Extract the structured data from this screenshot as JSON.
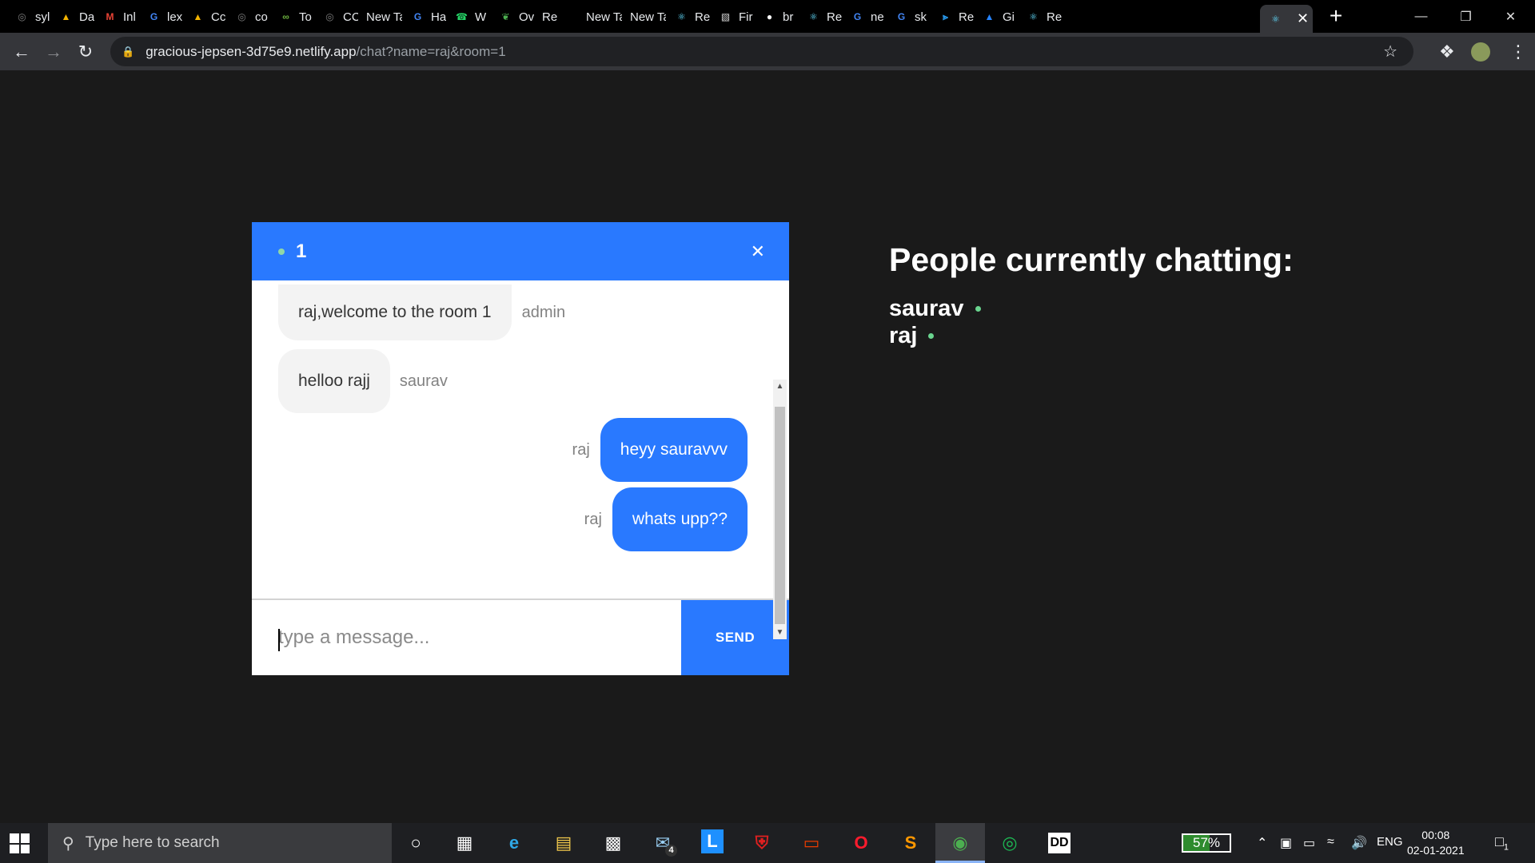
{
  "browser": {
    "tabs": [
      {
        "label": "syl",
        "favicon": "globe-icon",
        "color": "#7d7d7d"
      },
      {
        "label": "Da",
        "favicon": "drive-icon",
        "color": "#f4b400"
      },
      {
        "label": "Inl",
        "favicon": "gmail-icon",
        "color": "#ea4335"
      },
      {
        "label": "lex",
        "favicon": "google-icon",
        "color": "#4285f4"
      },
      {
        "label": "Cc",
        "favicon": "drive-icon",
        "color": "#f4b400"
      },
      {
        "label": "co",
        "favicon": "globe-icon",
        "color": "#7d7d7d"
      },
      {
        "label": "To",
        "favicon": "infinity-icon",
        "color": "#6db33f"
      },
      {
        "label": "CC",
        "favicon": "globe-icon",
        "color": "#7d7d7d"
      },
      {
        "label": "New Ta",
        "favicon": "",
        "color": ""
      },
      {
        "label": "Ha",
        "favicon": "google-icon",
        "color": "#4285f4"
      },
      {
        "label": "W",
        "favicon": "whatsapp-icon",
        "color": "#25d366"
      },
      {
        "label": "Ov",
        "favicon": "leaf-icon",
        "color": "#4caf50"
      },
      {
        "label": "Re",
        "favicon": "",
        "color": ""
      },
      {
        "label": "New Ta",
        "favicon": "",
        "color": ""
      },
      {
        "label": "New Ta",
        "favicon": "",
        "color": ""
      },
      {
        "label": "Re",
        "favicon": "react-icon",
        "color": "#61dafb"
      },
      {
        "label": "Fir",
        "favicon": "image-icon",
        "color": "#dddddd"
      },
      {
        "label": "br",
        "favicon": "github-icon",
        "color": "#ffffff"
      },
      {
        "label": "Re",
        "favicon": "react-icon",
        "color": "#61dafb"
      },
      {
        "label": "ne",
        "favicon": "google-icon",
        "color": "#4285f4"
      },
      {
        "label": "sk",
        "favicon": "google-icon",
        "color": "#4285f4"
      },
      {
        "label": "Re",
        "favicon": "vscode-icon",
        "color": "#2a9ef4"
      },
      {
        "label": "Gi",
        "favicon": "atlassian-icon",
        "color": "#2684ff"
      },
      {
        "label": "Re",
        "favicon": "react-icon",
        "color": "#61dafb"
      }
    ],
    "active_tab_favicon": "react-icon",
    "url_host": "gracious-jepsen-3d75e9.netlify.app",
    "url_path": "/chat?name=raj&room=1"
  },
  "chat": {
    "room": "1",
    "input_placeholder": "type a message...",
    "send_label": "SEND",
    "messages": [
      {
        "text": "raj,welcome to the room 1",
        "sender": "admin",
        "mine": false
      },
      {
        "text": "helloo rajj",
        "sender": "saurav",
        "mine": false
      },
      {
        "text": "heyy sauravvv",
        "sender": "raj",
        "mine": true
      },
      {
        "text": "whats upp??",
        "sender": "raj",
        "mine": true
      }
    ]
  },
  "people": {
    "title": "People currently chatting:",
    "users": [
      "saurav",
      "raj"
    ]
  },
  "taskbar": {
    "search_placeholder": "Type here to search",
    "mail_badge": "4",
    "battery": "57%",
    "battery_level": 0.57,
    "language": "ENG",
    "time": "00:08",
    "date": "02-01-2021",
    "notifications": "1"
  },
  "colors": {
    "accent": "#2979ff",
    "page_bg": "#1a1a1a",
    "online": "#6ad58f"
  }
}
